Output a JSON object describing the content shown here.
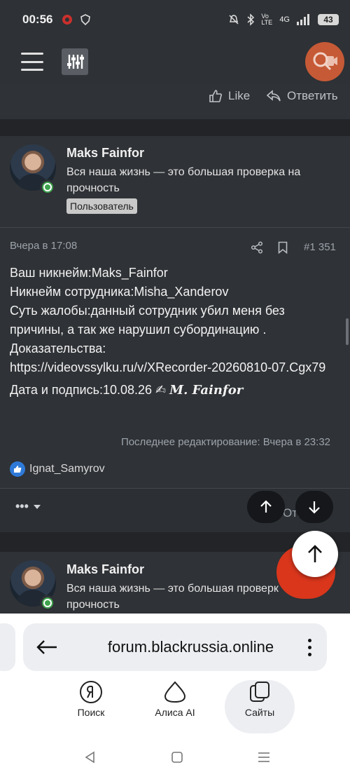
{
  "status_bar": {
    "time": "00:56",
    "network": "4G",
    "volte": "Vo LTE",
    "battery": "43"
  },
  "app_bar": {
    "menu_icon": "hamburger-icon",
    "filter_icon": "sliders-icon",
    "search_icon": "search-icon",
    "accent": "#c65a36"
  },
  "prev_post": {
    "like_label": "Like",
    "reply_label": "Ответить"
  },
  "post": {
    "author": {
      "name": "Maks Fainfor",
      "title": "Вся наша жизнь — это большая проверка на прочность",
      "badge": "Пользователь"
    },
    "time": "Вчера в 17:08",
    "number": "#1 351",
    "lines": [
      "Ваш никнейм:Maks_Fainfor",
      "Никнейм сотрудника:Misha_Xanderov",
      "Суть жалобы:данный сотрудник убил меня без причины, а так же нарушил субординацию .",
      "Доказательства:",
      "https://videovssylku.ru/v/XRecorder-20260810-07.Cgx79"
    ],
    "signature_prefix": "Дата и подпись:10.08.26 ✍",
    "signature_name": "M. Fainfor",
    "edited": "Последнее редактирование: Вчера в 23:32",
    "reactor": "Ignat_Samyrov",
    "reply_ghost": "Отв"
  },
  "next_post": {
    "author": {
      "name": "Maks Fainfor",
      "title": "Вся наша жизнь — это большая проверк прочность"
    }
  },
  "browser": {
    "url": "forum.blackrussia.online",
    "nav": [
      {
        "label": "Поиск",
        "icon": "yandex-icon"
      },
      {
        "label": "Алиса AI",
        "icon": "alice-icon"
      },
      {
        "label": "Сайты",
        "icon": "tabs-icon"
      }
    ]
  }
}
